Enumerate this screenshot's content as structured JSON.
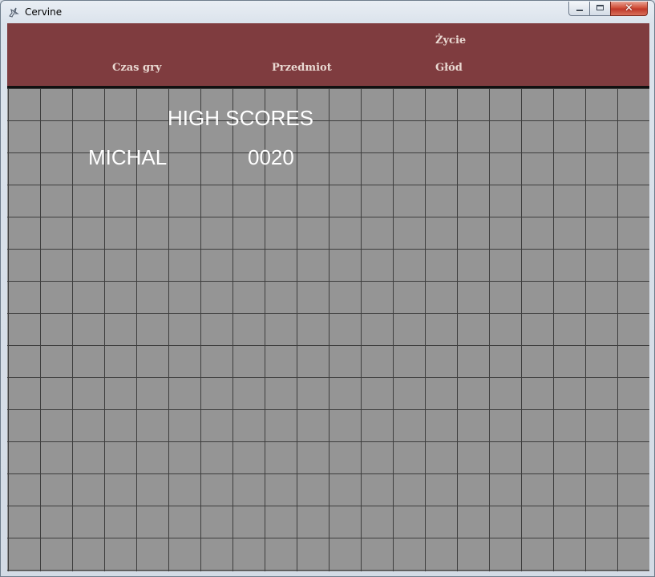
{
  "window": {
    "title": "Cervine",
    "icon": "cervine-app-icon",
    "controls": {
      "minimize_icon": "minimize-icon",
      "maximize_icon": "maximize-icon",
      "close_label": "✕"
    }
  },
  "hud": {
    "background_color": "#7f3c3f",
    "play_time_label": "Czas gry",
    "item_label": "Przedmiot",
    "life_label": "Życie",
    "hunger_label": "Głód"
  },
  "board": {
    "background_color": "#959595",
    "grid_color": "#3e3e3e"
  },
  "high_scores": {
    "title": "HIGH SCORES",
    "entries": [
      {
        "name": "MICHAL",
        "score": "0020"
      }
    ]
  }
}
